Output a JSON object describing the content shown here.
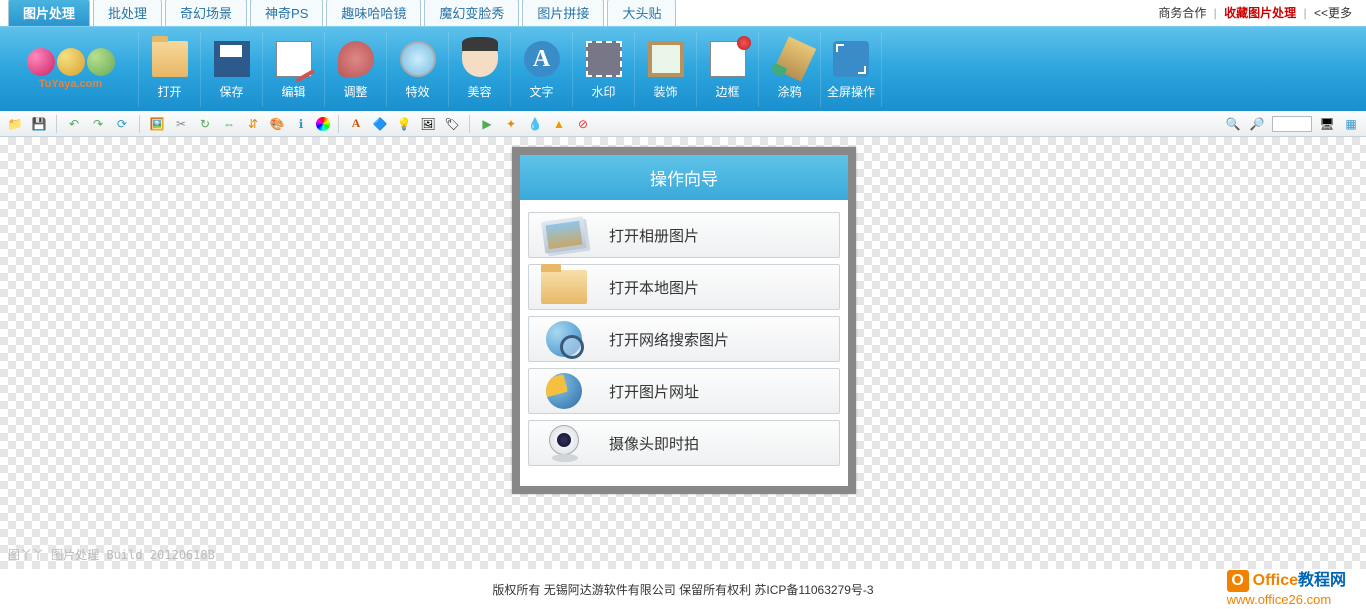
{
  "top_links": {
    "business": "商务合作",
    "favorite": "收藏图片处理",
    "more": "<<更多"
  },
  "tabs": [
    {
      "label": "图片处理",
      "active": true
    },
    {
      "label": "批处理",
      "active": false
    },
    {
      "label": "奇幻场景",
      "active": false
    },
    {
      "label": "神奇PS",
      "active": false
    },
    {
      "label": "趣味哈哈镜",
      "active": false
    },
    {
      "label": "魔幻变脸秀",
      "active": false
    },
    {
      "label": "图片拼接",
      "active": false
    },
    {
      "label": "大头贴",
      "active": false
    }
  ],
  "logo_text": "TuYaya.com",
  "toolbar": [
    {
      "label": "打开",
      "icon": "folder"
    },
    {
      "label": "保存",
      "icon": "save"
    },
    {
      "label": "编辑",
      "icon": "edit"
    },
    {
      "label": "调整",
      "icon": "palette"
    },
    {
      "label": "特效",
      "icon": "lens"
    },
    {
      "label": "美容",
      "icon": "face"
    },
    {
      "label": "文字",
      "icon": "text"
    },
    {
      "label": "水印",
      "icon": "stamp"
    },
    {
      "label": "装饰",
      "icon": "frame"
    },
    {
      "label": "边框",
      "icon": "border"
    },
    {
      "label": "涂鸦",
      "icon": "brush"
    },
    {
      "label": "全屏操作",
      "icon": "fullscreen"
    }
  ],
  "sub_toolbar_input": "",
  "wizard": {
    "title": "操作向导",
    "items": [
      {
        "label": "打开相册图片",
        "icon": "album"
      },
      {
        "label": "打开本地图片",
        "icon": "folder"
      },
      {
        "label": "打开网络搜索图片",
        "icon": "search-globe"
      },
      {
        "label": "打开图片网址",
        "icon": "url-globe"
      },
      {
        "label": "摄像头即时拍",
        "icon": "webcam"
      }
    ]
  },
  "build_info": "图丫丫 图片处理 Build 20120618B",
  "footer": {
    "copyright": "版权所有 无锡阿达游软件有限公司 保留所有权利 苏ICP备11063279号-3",
    "logo_text1": "Office",
    "logo_text2": "教程网",
    "logo_url": "www.office26.com"
  }
}
